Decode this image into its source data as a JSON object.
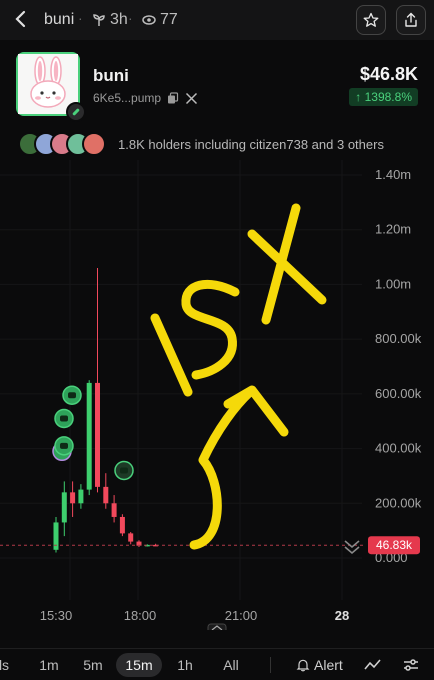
{
  "topbar": {
    "title": "buni",
    "age": "3h",
    "views": "77",
    "icons": [
      "back-icon",
      "sprout-icon",
      "eye-icon",
      "star-icon",
      "share-icon"
    ]
  },
  "token": {
    "name": "buni",
    "address": "6Ke5...pump",
    "price": "$46.8K",
    "change": "↑ 1398.8%",
    "change_color": "#4ad07c"
  },
  "holders": {
    "text": "1.8K holders including citizen738 and 3 others"
  },
  "chart": {
    "y_ticks": [
      "1.40m",
      "1.20m",
      "1.00m",
      "800.00k",
      "600.00k",
      "400.00k",
      "200.00k",
      "0.000"
    ],
    "x_ticks": [
      "15:30",
      "18:00",
      "21:00",
      "28"
    ],
    "current_price_label": "46.83k",
    "annotation": "15X",
    "up_color": "#3ecf6e",
    "down_color": "#f2495c",
    "annotation_color": "#f5d90a"
  },
  "chart_data": {
    "type": "candlestick",
    "ylim": [
      0,
      1400000
    ],
    "current_price": 46830,
    "candles": [
      {
        "o": 30000,
        "h": 150000,
        "l": 20000,
        "c": 130000
      },
      {
        "o": 130000,
        "h": 280000,
        "l": 80000,
        "c": 240000
      },
      {
        "o": 240000,
        "h": 280000,
        "l": 150000,
        "c": 200000
      },
      {
        "o": 200000,
        "h": 270000,
        "l": 180000,
        "c": 250000
      },
      {
        "o": 250000,
        "h": 650000,
        "l": 230000,
        "c": 640000
      },
      {
        "o": 640000,
        "h": 1060000,
        "l": 240000,
        "c": 260000
      },
      {
        "o": 260000,
        "h": 310000,
        "l": 180000,
        "c": 200000
      },
      {
        "o": 200000,
        "h": 230000,
        "l": 130000,
        "c": 150000
      },
      {
        "o": 150000,
        "h": 160000,
        "l": 80000,
        "c": 90000
      },
      {
        "o": 90000,
        "h": 95000,
        "l": 50000,
        "c": 60000
      },
      {
        "o": 60000,
        "h": 65000,
        "l": 40000,
        "c": 45000
      },
      {
        "o": 45000,
        "h": 50000,
        "l": 42000,
        "c": 48000
      },
      {
        "o": 48000,
        "h": 52000,
        "l": 44000,
        "c": 46830
      }
    ]
  },
  "timeframes": {
    "items": [
      "ls",
      "1m",
      "5m",
      "15m",
      "1h",
      "All"
    ],
    "active": "15m",
    "alert_label": "Alert"
  }
}
